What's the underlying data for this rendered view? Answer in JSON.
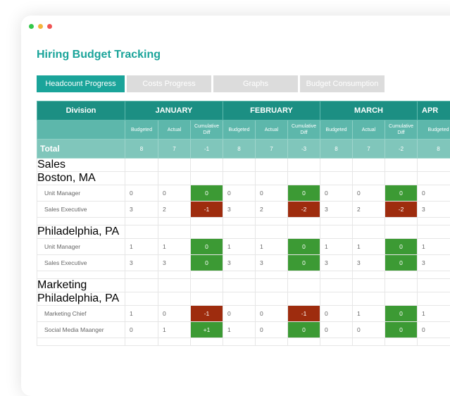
{
  "window": {
    "dots": [
      {
        "name": "window-dot-green-icon",
        "color": "#34c84a"
      },
      {
        "name": "window-dot-yellow-icon",
        "color": "#f4b43a"
      },
      {
        "name": "window-dot-red-icon",
        "color": "#f05454"
      }
    ]
  },
  "title": "Hiring Budget Tracking",
  "tabs": [
    {
      "label": "Headcount Progress",
      "active": true
    },
    {
      "label": "Costs Progress",
      "active": false
    },
    {
      "label": "Graphs",
      "active": false
    },
    {
      "label": "Budget Consumption",
      "active": false
    }
  ],
  "table": {
    "division_header": "Division",
    "months": [
      "JANUARY",
      "FEBRUARY",
      "MARCH",
      "APR"
    ],
    "subheaders": [
      "Budgeted",
      "Actual",
      "Cumulative Diff"
    ],
    "total": {
      "label": "Total",
      "values": [
        "8",
        "7",
        "-1",
        "8",
        "7",
        "-3",
        "8",
        "7",
        "-2",
        "8"
      ]
    },
    "rows": [
      {
        "type": "section",
        "label": "Sales"
      },
      {
        "type": "location",
        "label": "Boston, MA"
      },
      {
        "type": "role",
        "label": "Unit Manager",
        "values": [
          "0",
          "0",
          "0",
          "0",
          "0",
          "0",
          "0",
          "0",
          "0",
          "0"
        ]
      },
      {
        "type": "role",
        "label": "Sales Executive",
        "values": [
          "3",
          "2",
          "-1",
          "3",
          "2",
          "-2",
          "3",
          "2",
          "-2",
          "3"
        ]
      },
      {
        "type": "blank"
      },
      {
        "type": "location",
        "label": "Philadelphia, PA"
      },
      {
        "type": "role",
        "label": "Unit Manager",
        "values": [
          "1",
          "1",
          "0",
          "1",
          "1",
          "0",
          "1",
          "1",
          "0",
          "1"
        ]
      },
      {
        "type": "role",
        "label": "Sales Executive",
        "values": [
          "3",
          "3",
          "0",
          "3",
          "3",
          "0",
          "3",
          "3",
          "0",
          "3"
        ]
      },
      {
        "type": "blank"
      },
      {
        "type": "section",
        "label": "Marketing"
      },
      {
        "type": "location",
        "label": "Philadelphia, PA"
      },
      {
        "type": "role",
        "label": "Marketing Chief",
        "values": [
          "1",
          "0",
          "-1",
          "0",
          "0",
          "-1",
          "0",
          "1",
          "0",
          "1"
        ]
      },
      {
        "type": "role",
        "label": "Social Media Maanger",
        "values": [
          "0",
          "1",
          "+1",
          "1",
          "0",
          "0",
          "0",
          "0",
          "0",
          "0"
        ]
      },
      {
        "type": "blank"
      }
    ]
  }
}
